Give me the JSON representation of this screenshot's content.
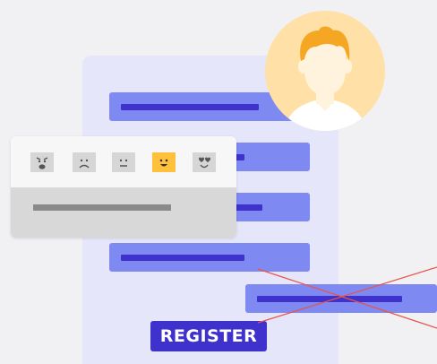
{
  "register_button": {
    "label": "REGISTER"
  },
  "rating": {
    "emojis": [
      "angry-face-icon",
      "frown-face-icon",
      "neutral-face-icon",
      "smile-face-icon",
      "heart-eyes-face-icon"
    ],
    "selected": "smile-face-icon"
  },
  "avatar": {
    "icon": "user-avatar-icon"
  },
  "colors": {
    "background": "#f1f1f3",
    "panel": "#e6e6fb",
    "field": "#7f89f2",
    "field_line": "#3f31cc",
    "button": "#3f31cc",
    "avatar_bg": "#ffe0a6",
    "hair": "#f5a623",
    "selected_emoji": "#ffc03b",
    "cross_line": "#e8534a"
  }
}
